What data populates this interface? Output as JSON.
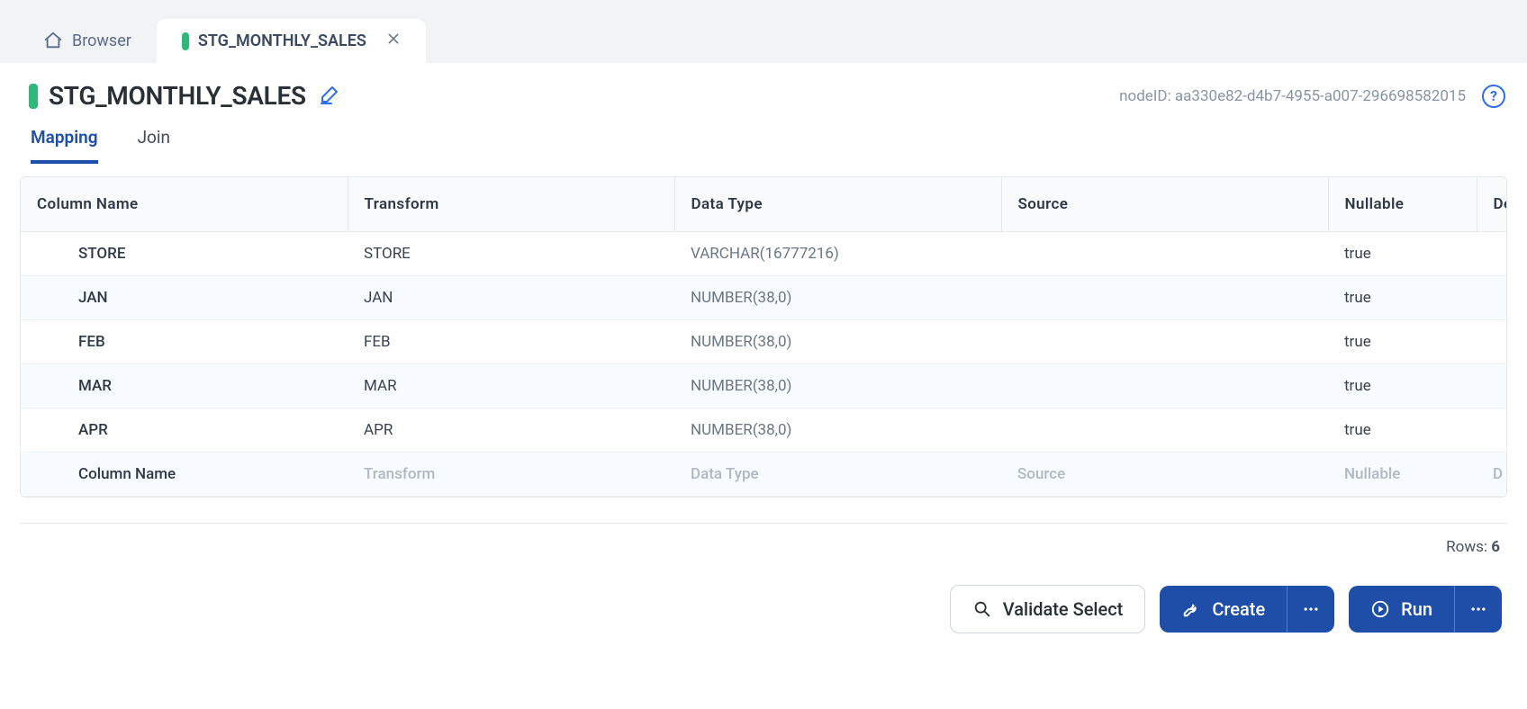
{
  "tabs": {
    "browser_label": "Browser",
    "active_tab_label": "STG_MONTHLY_SALES"
  },
  "header": {
    "title": "STG_MONTHLY_SALES",
    "node_id_label": "nodeID: aa330e82-d4b7-4955-a007-296698582015"
  },
  "subtabs": {
    "mapping": "Mapping",
    "join": "Join"
  },
  "table": {
    "headers": {
      "column_name": "Column Name",
      "transform": "Transform",
      "data_type": "Data Type",
      "source": "Source",
      "nullable": "Nullable",
      "description": "Des"
    },
    "rows": [
      {
        "name": "STORE",
        "transform": "STORE",
        "type": "VARCHAR(16777216)",
        "source": "",
        "nullable": "true"
      },
      {
        "name": "JAN",
        "transform": "JAN",
        "type": "NUMBER(38,0)",
        "source": "",
        "nullable": "true"
      },
      {
        "name": "FEB",
        "transform": "FEB",
        "type": "NUMBER(38,0)",
        "source": "",
        "nullable": "true"
      },
      {
        "name": "MAR",
        "transform": "MAR",
        "type": "NUMBER(38,0)",
        "source": "",
        "nullable": "true"
      },
      {
        "name": "APR",
        "transform": "APR",
        "type": "NUMBER(38,0)",
        "source": "",
        "nullable": "true"
      }
    ],
    "placeholder": {
      "column_name": "Column Name",
      "transform": "Transform",
      "data_type": "Data Type",
      "source": "Source",
      "nullable": "Nullable",
      "description": "D"
    }
  },
  "footer": {
    "rows_label": "Rows:",
    "rows_count": "6"
  },
  "actions": {
    "validate": "Validate Select",
    "create": "Create",
    "run": "Run"
  }
}
